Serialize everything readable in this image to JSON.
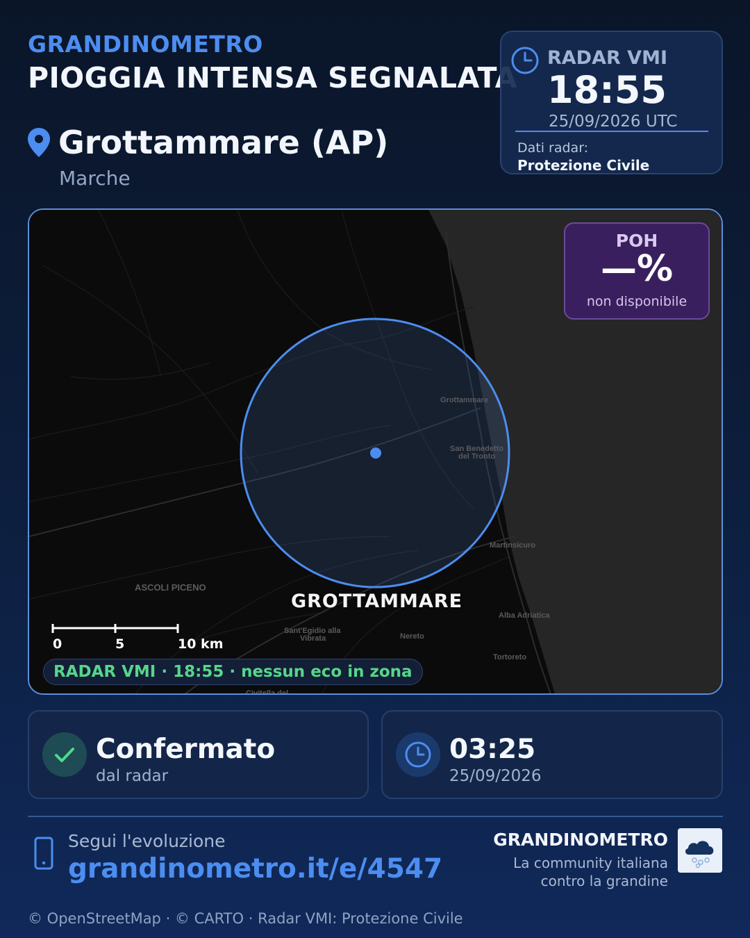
{
  "brand": "GRANDINOMETRO",
  "headline": "PIOGGIA INTENSA SEGNALATA",
  "location": {
    "name": "Grottammare (AP)",
    "region": "Marche",
    "icon": "map-pin-icon"
  },
  "radar_card": {
    "label": "RADAR VMI",
    "time": "18:55",
    "date": "25/09/2026 UTC",
    "source_label": "Dati radar:",
    "source_name": "Protezione Civile",
    "icon": "clock-icon"
  },
  "map": {
    "poh_label": "POH",
    "poh_value": "—%",
    "poh_sub": "non disponibile",
    "zone_label": "GROTTAMMARE",
    "place_labels": {
      "grottammare": "Grottammare",
      "san_benedetto_1": "San Benedetto",
      "san_benedetto_2": "del Tronto",
      "martinsicuro": "Martinsicuro",
      "ascoli": "ASCOLI PICENO",
      "alba": "Alba Adriatica",
      "santegidio_1": "Sant'Egidio alla",
      "santegidio_2": "Vibrata",
      "nereto": "Nereto",
      "tortoreto": "Tortoreto",
      "civitella": "Civitella del"
    },
    "scale": [
      "0",
      "5",
      "10 km"
    ],
    "radar_status": "RADAR VMI · 18:55 · nessun eco in zona",
    "colors": {
      "circle": "#4c8df0",
      "status": "#56d68a",
      "poh_bg": "#3a1f5e"
    }
  },
  "cards": {
    "confirmed": {
      "title": "Confermato",
      "subtitle": "dal radar",
      "icon": "check-icon"
    },
    "time": {
      "title": "03:25",
      "subtitle": "25/09/2026",
      "icon": "clock-icon"
    }
  },
  "footer": {
    "follow": "Segui l'evoluzione",
    "url": "grandinometro.it/e/4547",
    "brand": "GRANDINOMETRO",
    "tagline_1": "La community italiana",
    "tagline_2": "contro la grandine",
    "credits": "© OpenStreetMap · © CARTO · Radar VMI: Protezione Civile",
    "icons": [
      "phone-icon",
      "hail-cloud-icon"
    ]
  }
}
